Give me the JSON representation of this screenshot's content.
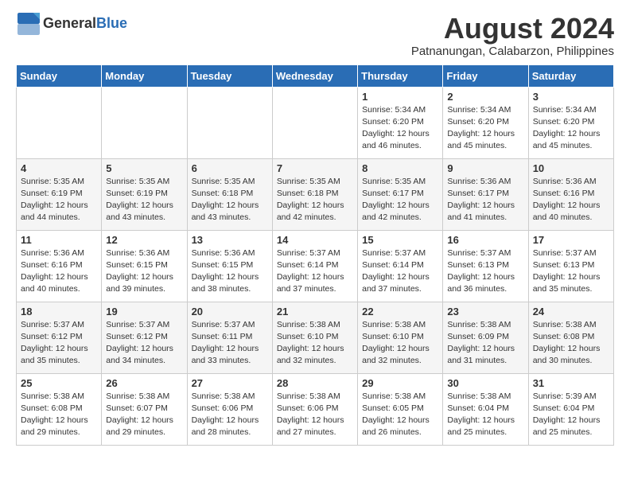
{
  "header": {
    "logo": {
      "general": "General",
      "blue": "Blue"
    },
    "title": "August 2024",
    "location": "Patnanungan, Calabarzon, Philippines"
  },
  "days_of_week": [
    "Sunday",
    "Monday",
    "Tuesday",
    "Wednesday",
    "Thursday",
    "Friday",
    "Saturday"
  ],
  "weeks": [
    [
      {
        "day": "",
        "info": ""
      },
      {
        "day": "",
        "info": ""
      },
      {
        "day": "",
        "info": ""
      },
      {
        "day": "",
        "info": ""
      },
      {
        "day": "1",
        "info": "Sunrise: 5:34 AM\nSunset: 6:20 PM\nDaylight: 12 hours\nand 46 minutes."
      },
      {
        "day": "2",
        "info": "Sunrise: 5:34 AM\nSunset: 6:20 PM\nDaylight: 12 hours\nand 45 minutes."
      },
      {
        "day": "3",
        "info": "Sunrise: 5:34 AM\nSunset: 6:20 PM\nDaylight: 12 hours\nand 45 minutes."
      }
    ],
    [
      {
        "day": "4",
        "info": "Sunrise: 5:35 AM\nSunset: 6:19 PM\nDaylight: 12 hours\nand 44 minutes."
      },
      {
        "day": "5",
        "info": "Sunrise: 5:35 AM\nSunset: 6:19 PM\nDaylight: 12 hours\nand 43 minutes."
      },
      {
        "day": "6",
        "info": "Sunrise: 5:35 AM\nSunset: 6:18 PM\nDaylight: 12 hours\nand 43 minutes."
      },
      {
        "day": "7",
        "info": "Sunrise: 5:35 AM\nSunset: 6:18 PM\nDaylight: 12 hours\nand 42 minutes."
      },
      {
        "day": "8",
        "info": "Sunrise: 5:35 AM\nSunset: 6:17 PM\nDaylight: 12 hours\nand 42 minutes."
      },
      {
        "day": "9",
        "info": "Sunrise: 5:36 AM\nSunset: 6:17 PM\nDaylight: 12 hours\nand 41 minutes."
      },
      {
        "day": "10",
        "info": "Sunrise: 5:36 AM\nSunset: 6:16 PM\nDaylight: 12 hours\nand 40 minutes."
      }
    ],
    [
      {
        "day": "11",
        "info": "Sunrise: 5:36 AM\nSunset: 6:16 PM\nDaylight: 12 hours\nand 40 minutes."
      },
      {
        "day": "12",
        "info": "Sunrise: 5:36 AM\nSunset: 6:15 PM\nDaylight: 12 hours\nand 39 minutes."
      },
      {
        "day": "13",
        "info": "Sunrise: 5:36 AM\nSunset: 6:15 PM\nDaylight: 12 hours\nand 38 minutes."
      },
      {
        "day": "14",
        "info": "Sunrise: 5:37 AM\nSunset: 6:14 PM\nDaylight: 12 hours\nand 37 minutes."
      },
      {
        "day": "15",
        "info": "Sunrise: 5:37 AM\nSunset: 6:14 PM\nDaylight: 12 hours\nand 37 minutes."
      },
      {
        "day": "16",
        "info": "Sunrise: 5:37 AM\nSunset: 6:13 PM\nDaylight: 12 hours\nand 36 minutes."
      },
      {
        "day": "17",
        "info": "Sunrise: 5:37 AM\nSunset: 6:13 PM\nDaylight: 12 hours\nand 35 minutes."
      }
    ],
    [
      {
        "day": "18",
        "info": "Sunrise: 5:37 AM\nSunset: 6:12 PM\nDaylight: 12 hours\nand 35 minutes."
      },
      {
        "day": "19",
        "info": "Sunrise: 5:37 AM\nSunset: 6:12 PM\nDaylight: 12 hours\nand 34 minutes."
      },
      {
        "day": "20",
        "info": "Sunrise: 5:37 AM\nSunset: 6:11 PM\nDaylight: 12 hours\nand 33 minutes."
      },
      {
        "day": "21",
        "info": "Sunrise: 5:38 AM\nSunset: 6:10 PM\nDaylight: 12 hours\nand 32 minutes."
      },
      {
        "day": "22",
        "info": "Sunrise: 5:38 AM\nSunset: 6:10 PM\nDaylight: 12 hours\nand 32 minutes."
      },
      {
        "day": "23",
        "info": "Sunrise: 5:38 AM\nSunset: 6:09 PM\nDaylight: 12 hours\nand 31 minutes."
      },
      {
        "day": "24",
        "info": "Sunrise: 5:38 AM\nSunset: 6:08 PM\nDaylight: 12 hours\nand 30 minutes."
      }
    ],
    [
      {
        "day": "25",
        "info": "Sunrise: 5:38 AM\nSunset: 6:08 PM\nDaylight: 12 hours\nand 29 minutes."
      },
      {
        "day": "26",
        "info": "Sunrise: 5:38 AM\nSunset: 6:07 PM\nDaylight: 12 hours\nand 29 minutes."
      },
      {
        "day": "27",
        "info": "Sunrise: 5:38 AM\nSunset: 6:06 PM\nDaylight: 12 hours\nand 28 minutes."
      },
      {
        "day": "28",
        "info": "Sunrise: 5:38 AM\nSunset: 6:06 PM\nDaylight: 12 hours\nand 27 minutes."
      },
      {
        "day": "29",
        "info": "Sunrise: 5:38 AM\nSunset: 6:05 PM\nDaylight: 12 hours\nand 26 minutes."
      },
      {
        "day": "30",
        "info": "Sunrise: 5:38 AM\nSunset: 6:04 PM\nDaylight: 12 hours\nand 25 minutes."
      },
      {
        "day": "31",
        "info": "Sunrise: 5:39 AM\nSunset: 6:04 PM\nDaylight: 12 hours\nand 25 minutes."
      }
    ]
  ]
}
